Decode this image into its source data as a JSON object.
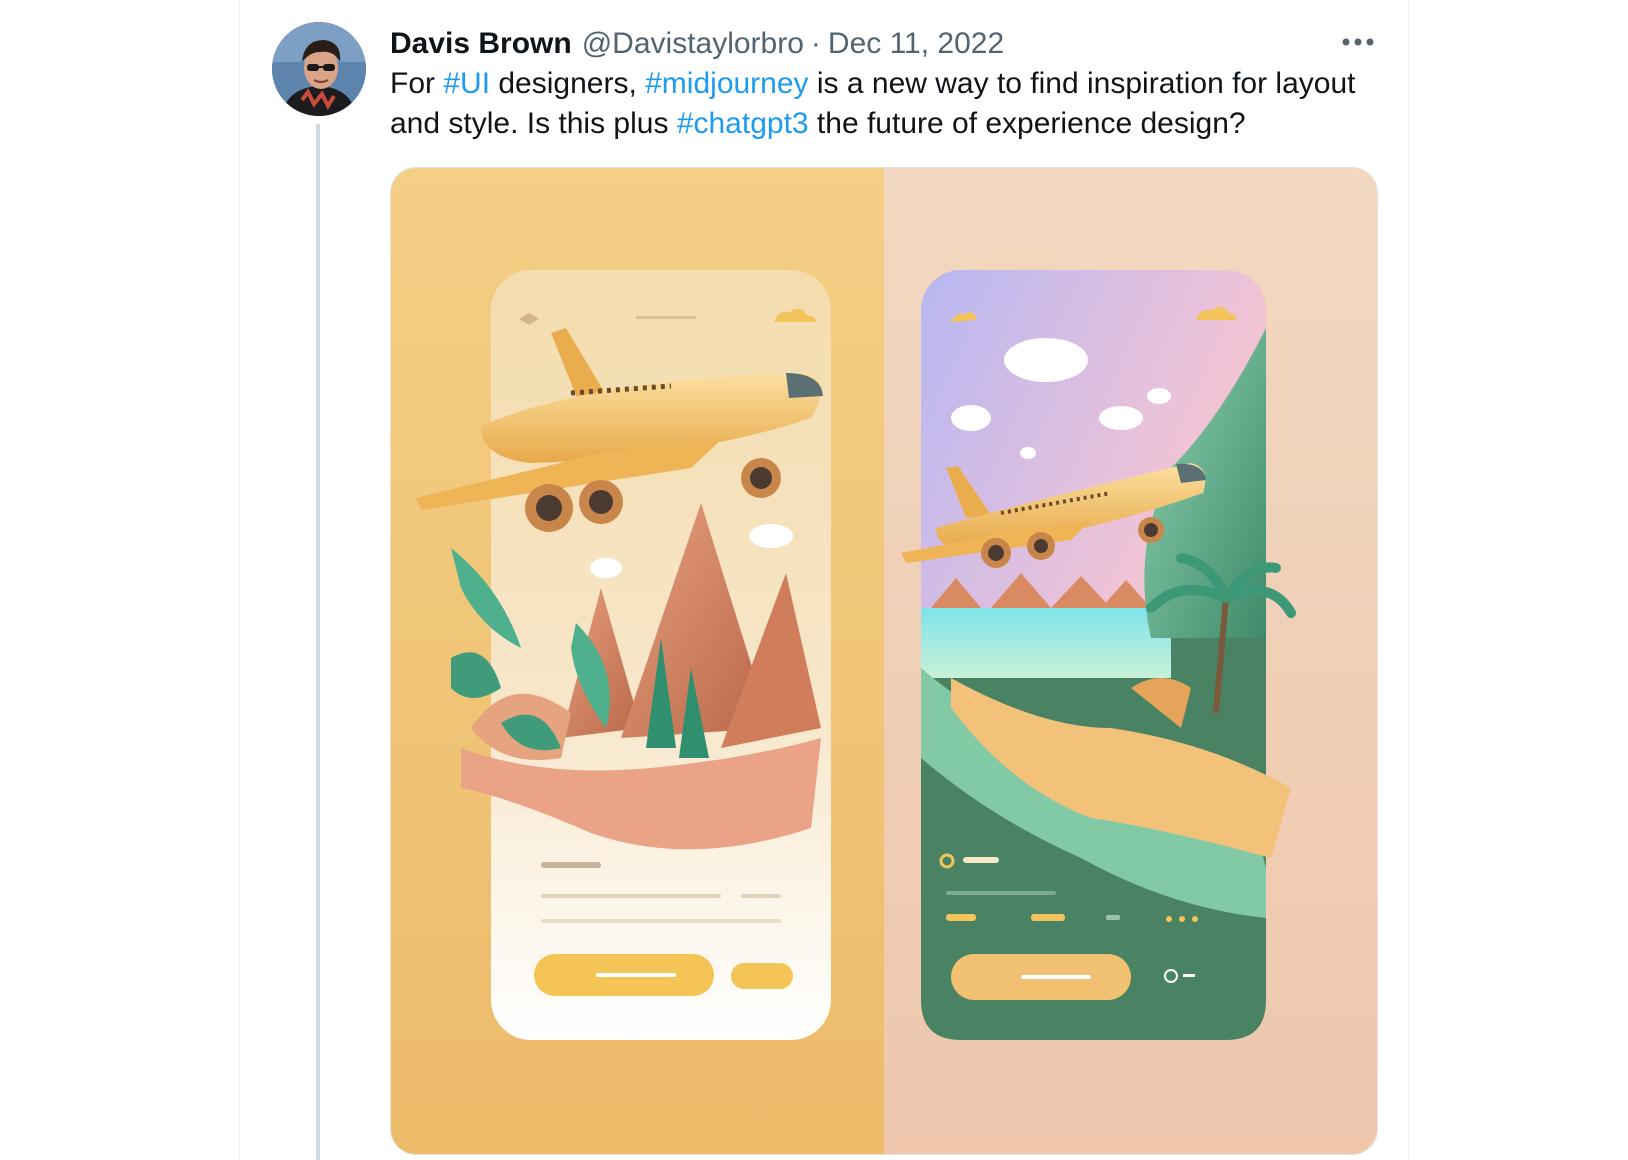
{
  "tweet": {
    "author_name": "Davis Brown",
    "author_handle": "@Davistaylorbro",
    "separator": "·",
    "date": "Dec 11, 2022",
    "text_parts": [
      {
        "text": "For ",
        "type": "text"
      },
      {
        "text": "#UI",
        "type": "hashtag"
      },
      {
        "text": " designers, ",
        "type": "text"
      },
      {
        "text": "#midjourney",
        "type": "hashtag"
      },
      {
        "text": " is a new way to find inspiration for layout and style. Is this plus ",
        "type": "text"
      },
      {
        "text": "#chatgpt3",
        "type": "hashtag"
      },
      {
        "text": " the future of experience design?",
        "type": "text"
      }
    ]
  },
  "icons": {
    "more": "more-dots-icon",
    "avatar": "profile-avatar",
    "media": "airplane-app-mockups"
  },
  "colors": {
    "hashtag": "#1d9bf0",
    "secondary_text": "#536471",
    "thread_line": "#cfd9de",
    "media_left_bg": "#f0c979",
    "media_right_bg": "#f0d2b6",
    "accent_yellow": "#f3c35c",
    "green_card": "#4f8a6c"
  }
}
